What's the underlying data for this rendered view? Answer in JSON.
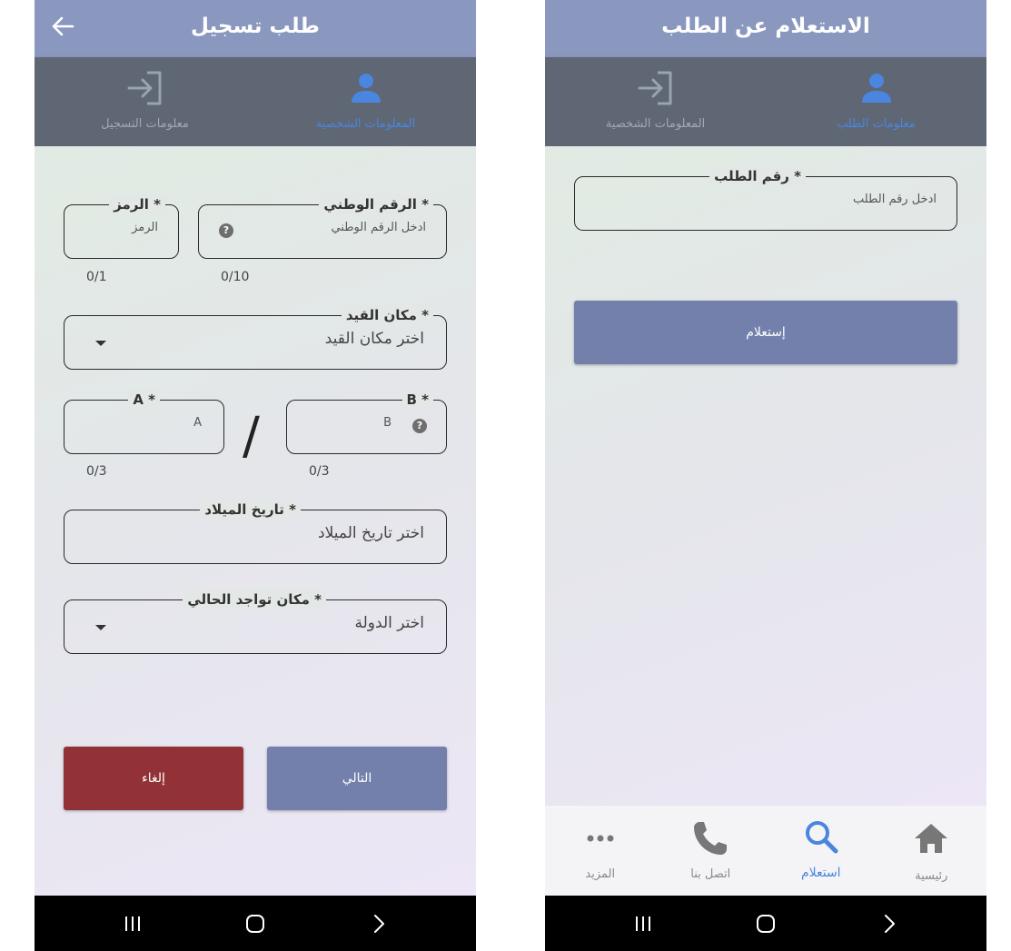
{
  "left_screen": {
    "title": "طلب تسجيل",
    "steps": [
      {
        "label": "المعلومات الشخصية",
        "state": "active",
        "icon": "person-icon"
      },
      {
        "label": "معلومات التسجيل",
        "state": "inactive",
        "icon": "login-icon"
      }
    ],
    "fields": {
      "national_id": {
        "label": "الرقم الوطني *",
        "placeholder": "ادخل الرقم الوطني",
        "counter": "0/10"
      },
      "code": {
        "label": "الرمز *",
        "placeholder": "الرمز",
        "counter": "0/1"
      },
      "registry_place": {
        "label": "مكان القيد *",
        "placeholder": "اختر مكان القيد"
      },
      "b": {
        "label": "B *",
        "placeholder": "B",
        "counter": "0/3"
      },
      "separator": "/",
      "a": {
        "label": "A *",
        "placeholder": "A",
        "counter": "0/3"
      },
      "birth_date": {
        "label": "تاريخ الميلاد *",
        "placeholder": "اختر تاريخ الميلاد"
      },
      "current_location": {
        "label": "مكان تواجد الحالي *",
        "placeholder": "اختر الدولة"
      }
    },
    "buttons": {
      "next": "التالي",
      "cancel": "إلغاء"
    }
  },
  "right_screen": {
    "title": "الاستعلام عن الطلب",
    "steps": [
      {
        "label": "معلومات الطلب",
        "state": "active",
        "icon": "person-icon"
      },
      {
        "label": "المعلومات الشخصية",
        "state": "inactive",
        "icon": "login-icon"
      }
    ],
    "fields": {
      "request_number": {
        "label": "رقم الطلب *",
        "placeholder": "ادخل رقم الطلب"
      }
    },
    "buttons": {
      "query": "إستعلام"
    },
    "bottom_nav": [
      {
        "label": "رئيسية",
        "icon": "home-icon",
        "active": false
      },
      {
        "label": "استعلام",
        "icon": "search-icon",
        "active": true
      },
      {
        "label": "اتصل بنا",
        "icon": "phone-icon",
        "active": false
      },
      {
        "label": "المزيد",
        "icon": "more-icon",
        "active": false
      }
    ]
  },
  "colors": {
    "appbar": "#8a97bf",
    "stepbar": "#5f6674",
    "active_blue": "#4a86e0",
    "primary_button": "#7280ab",
    "cancel_button": "#923236"
  }
}
